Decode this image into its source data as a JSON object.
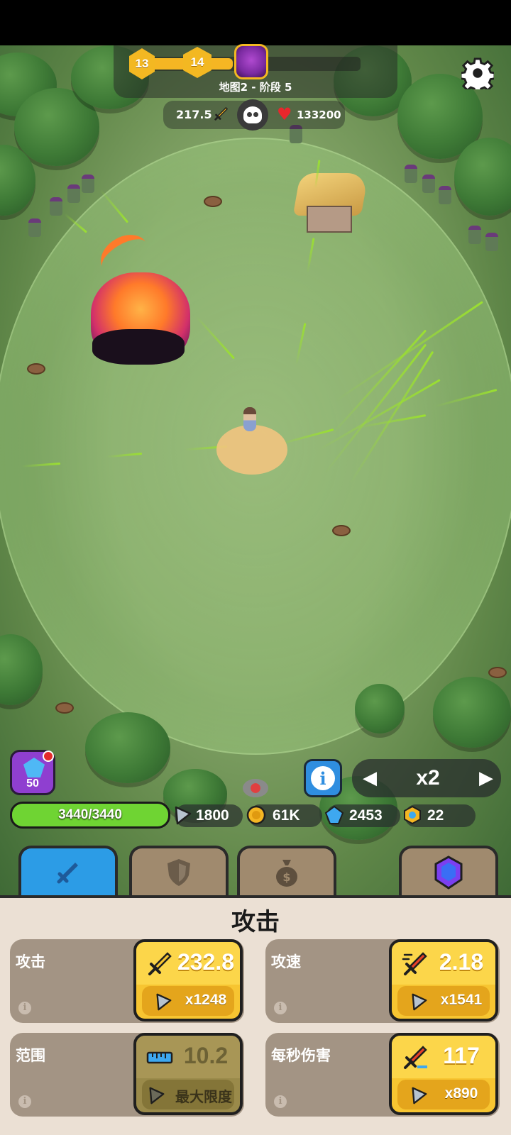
{
  "hud": {
    "stage": {
      "previous_level": "13",
      "current_level": "14",
      "label": "地图2 - 阶段 5",
      "progress_fraction": 0.42
    },
    "attack_power": "217.5",
    "enemy_hp": "133200",
    "settings_icon": "gear-icon"
  },
  "controls": {
    "gem_offer_count": "50",
    "speed": "x2",
    "speed_prev": "◀",
    "speed_next": "▶",
    "info_label": "i"
  },
  "player": {
    "hp_text": "3440/3440",
    "hp_fraction": 1.0
  },
  "resources": {
    "stone": "1800",
    "gold": "61K",
    "gems": "2453",
    "tokens": "22"
  },
  "tabs": [
    {
      "name": "attack",
      "icon": "sword-icon",
      "active": true
    },
    {
      "name": "defense",
      "icon": "shield-icon",
      "active": false
    },
    {
      "name": "economy",
      "icon": "money-bag-icon",
      "active": false
    },
    {
      "name": "gems",
      "icon": "crystal-icon",
      "active": false
    }
  ],
  "panel": {
    "title": "攻击",
    "upgrades": {
      "attack": {
        "name": "攻击",
        "value": "232.8",
        "cost": "x1248",
        "icon": "sword-icon"
      },
      "attack_speed": {
        "name": "攻速",
        "value": "2.18",
        "cost": "x1541",
        "icon": "fast-sword-icon"
      },
      "range": {
        "name": "范围",
        "value": "10.2",
        "cost": "最大限度",
        "icon": "ruler-icon",
        "maxed": true
      },
      "dps": {
        "name": "每秒伤害",
        "value": "117",
        "cost": "x890",
        "icon": "dps-sword-icon"
      }
    }
  },
  "colors": {
    "accent_yellow": "#f7c531",
    "tab_active": "#2c9ce6",
    "hp_green": "#6fd433",
    "panel_bg": "#ebe0d4"
  }
}
